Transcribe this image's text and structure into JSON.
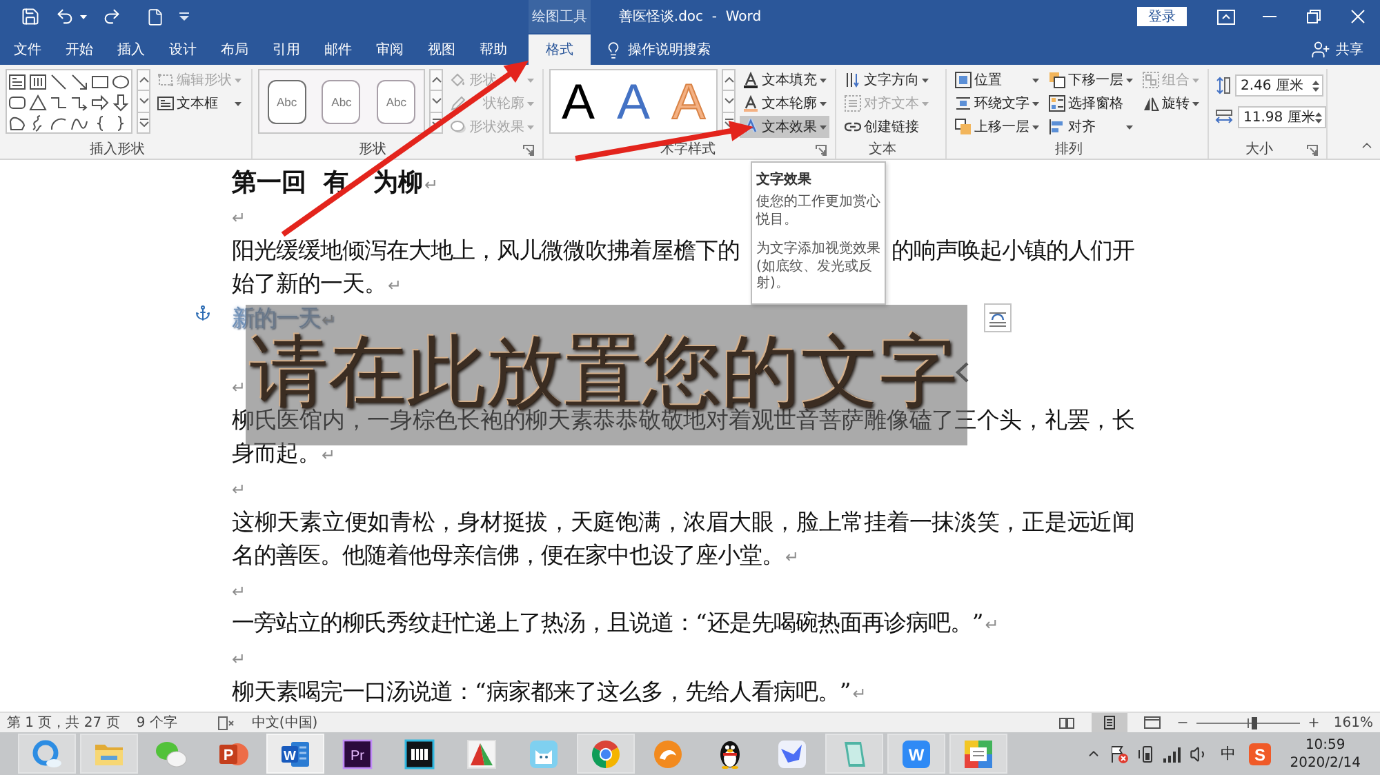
{
  "title_bar": {
    "context_label": "绘图工具",
    "title": "善医怪谈.doc  -  Word",
    "sign_in": "登录"
  },
  "tabs": [
    {
      "label": "文件",
      "selected": false
    },
    {
      "label": "开始",
      "selected": false
    },
    {
      "label": "插入",
      "selected": false
    },
    {
      "label": "设计",
      "selected": false
    },
    {
      "label": "布局",
      "selected": false
    },
    {
      "label": "引用",
      "selected": false
    },
    {
      "label": "邮件",
      "selected": false
    },
    {
      "label": "审阅",
      "selected": false
    },
    {
      "label": "视图",
      "selected": false
    },
    {
      "label": "帮助",
      "selected": false
    },
    {
      "label": "格式",
      "selected": true
    }
  ],
  "tell_me": {
    "label": "操作说明搜索"
  },
  "share": {
    "label": "共享"
  },
  "ribbon_groups": [
    {
      "kind": "shapes",
      "label": "插入形状",
      "launcher": false,
      "buttons": [
        [
          {
            "label": "编辑形状",
            "dropdown": true,
            "disabled": true,
            "hovered": false
          },
          {
            "label": "文本框",
            "dropdown": true,
            "disabled": false,
            "hovered": false
          }
        ]
      ]
    },
    {
      "kind": "shape_styles",
      "label": "形状",
      "launcher": true,
      "styles": [
        {
          "text": "Abc",
          "color": "#6e6e6e"
        },
        {
          "text": "Abc",
          "color": "#a89fa8"
        },
        {
          "text": "Abc",
          "color": "#a89fa8"
        }
      ],
      "buttons": [
        [
          {
            "label": "形状",
            "dropdown": true,
            "disabled": true,
            "hovered": false
          },
          {
            "label": "状轮廓",
            "dropdown": true,
            "disabled": true,
            "hovered": false
          },
          {
            "label": "形状效果",
            "dropdown": true,
            "disabled": true,
            "hovered": false
          }
        ]
      ]
    },
    {
      "kind": "wordart",
      "label": "术字样式",
      "launcher": true,
      "styles": [
        {
          "text": "A",
          "kind": "fill",
          "color": "#000000"
        },
        {
          "text": "A",
          "kind": "fill",
          "color": "#4472c4"
        },
        {
          "text": "A",
          "kind": "outline",
          "color": "#f4b183"
        }
      ],
      "buttons": [
        [
          {
            "label": "文本填充",
            "dropdown": true,
            "disabled": false,
            "hovered": false
          },
          {
            "label": "文本轮廓",
            "dropdown": true,
            "disabled": false,
            "hovered": false
          },
          {
            "label": "文本效果",
            "dropdown": true,
            "disabled": false,
            "hovered": true
          }
        ]
      ]
    },
    {
      "kind": "plain",
      "label": "文本",
      "launcher": false,
      "buttons": [
        [
          {
            "label": "文字方向",
            "dropdown": true,
            "disabled": false,
            "hovered": false
          },
          {
            "label": "对齐文本",
            "dropdown": true,
            "disabled": true,
            "hovered": false
          },
          {
            "label": "创建链接",
            "dropdown": false,
            "disabled": false,
            "hovered": false
          }
        ]
      ]
    },
    {
      "kind": "plain",
      "label": "排列",
      "launcher": false,
      "buttons": [
        [
          {
            "label": "位置",
            "dropdown": true,
            "disabled": false,
            "hovered": false
          },
          {
            "label": "环绕文字",
            "dropdown": true,
            "disabled": false,
            "hovered": false
          },
          {
            "label": "上移一层",
            "dropdown": true,
            "disabled": false,
            "hovered": false
          }
        ],
        [
          {
            "label": "下移一层",
            "dropdown": true,
            "disabled": false,
            "hovered": false
          },
          {
            "label": "选择窗格",
            "dropdown": false,
            "disabled": false,
            "hovered": false
          },
          {
            "label": "对齐",
            "dropdown": true,
            "disabled": false,
            "hovered": false
          }
        ],
        [
          {
            "label": "组合",
            "dropdown": true,
            "disabled": true,
            "hovered": false
          },
          {
            "label": "旋转",
            "dropdown": true,
            "disabled": false,
            "hovered": false
          }
        ]
      ]
    },
    {
      "kind": "size",
      "label": "大小",
      "launcher": true,
      "fields": [
        {
          "value": "2.46 厘米"
        },
        {
          "value": "11.98 厘米"
        }
      ]
    }
  ],
  "document": {
    "paragraphs": [
      {
        "kind": "heading",
        "text": "第一回  有",
        "text_after": "为柳",
        "mark": "↵"
      },
      {
        "kind": "empty",
        "mark": "↵"
      },
      {
        "kind": "split",
        "segments": [
          "阳光缓缓地倾泻在大地上，风儿微微吹拂着屋檐下的",
          "的响声唤起小镇的人们开",
          "始了新的一天。"
        ],
        "mark": "↵"
      },
      {
        "kind": "effect",
        "text": "新的一天",
        "mark": "↵"
      },
      {
        "kind": "covered"
      },
      {
        "kind": "empty",
        "mark": "↵"
      },
      {
        "kind": "body",
        "text": "柳氏医馆内，一身棕色长袍的柳天素恭恭敬敬地对着观世音菩萨雕像磕了三个头，礼罢，长身而起。",
        "mark": "↵"
      },
      {
        "kind": "empty",
        "mark": "↵"
      },
      {
        "kind": "body",
        "text": "这柳天素立便如青松，身材挺拔，天庭饱满，浓眉大眼，脸上常挂着一抹淡笑，正是远近闻名的善医。他随着他母亲信佛，便在家中也设了座小堂。",
        "mark": "↵"
      },
      {
        "kind": "empty",
        "mark": "↵"
      },
      {
        "kind": "body",
        "text": "一旁站立的柳氏秀纹赶忙递上了热汤，且说道：“还是先喝碗热面再诊病吧。”",
        "mark": "↵"
      },
      {
        "kind": "empty",
        "mark": "↵"
      },
      {
        "kind": "body",
        "text": "柳天素喝完一口汤说道：“病家都来了这么多，先给人看病吧。”",
        "mark": "↵"
      }
    ]
  },
  "text_box": {
    "text": "请在此放置您的文字"
  },
  "tooltip": {
    "title": "文字效果",
    "paragraphs": [
      "使您的工作更加赏心悦目。",
      "为文字添加视觉效果(如底纹、发光或反射)。"
    ]
  },
  "status_bar": {
    "page": "第 1 页，共 27 页",
    "words": "9 个字",
    "language": "中文(中国)",
    "views": [
      {
        "selected": false
      },
      {
        "selected": true
      },
      {
        "selected": false
      }
    ],
    "zoom": {
      "level": 0.56,
      "reading": "161%"
    }
  },
  "taskbar": {
    "apps": [
      {
        "kind": "browser",
        "running": true,
        "selected": false
      },
      {
        "kind": "folder",
        "running": true,
        "selected": false
      },
      {
        "kind": "chat",
        "running": false,
        "selected": false
      },
      {
        "kind": "slides",
        "glyph": "P",
        "running": false,
        "selected": false
      },
      {
        "kind": "document",
        "glyph": "W",
        "running": true,
        "selected": true
      },
      {
        "kind": "video",
        "glyph": "Pr",
        "running": false,
        "selected": false
      },
      {
        "kind": "film",
        "running": false,
        "selected": false
      },
      {
        "kind": "paint",
        "running": false,
        "selected": false
      },
      {
        "kind": "cat",
        "running": false,
        "selected": false
      },
      {
        "kind": "wheel",
        "running": true,
        "selected": false
      },
      {
        "kind": "fox",
        "running": false,
        "selected": false
      },
      {
        "kind": "penguin",
        "running": false,
        "selected": false
      },
      {
        "kind": "bird",
        "running": false,
        "selected": false
      },
      {
        "kind": "notepad",
        "running": true,
        "selected": false
      },
      {
        "kind": "tile",
        "glyph": "W",
        "running": true,
        "selected": false
      },
      {
        "kind": "board",
        "running": true,
        "selected": false
      }
    ],
    "tray": {
      "ime": "中",
      "ime_logo": "S",
      "time": "10:59",
      "date": "2020/2/14"
    }
  }
}
